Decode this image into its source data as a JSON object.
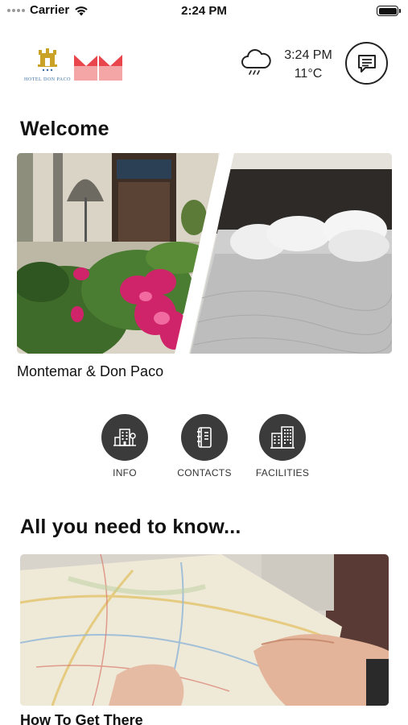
{
  "status_bar": {
    "carrier": "Carrier",
    "time": "2:24 PM"
  },
  "header": {
    "logo_text": "HOTEL DON PACO",
    "weather": {
      "time": "3:24 PM",
      "temperature": "11°C",
      "icon": "cloud-rain-icon"
    },
    "chat_icon": "chat-icon"
  },
  "welcome": {
    "title": "Welcome",
    "hotel_name": "Montemar & Don Paco"
  },
  "actions": [
    {
      "label": "INFO",
      "icon": "info-building-icon"
    },
    {
      "label": "CONTACTS",
      "icon": "address-book-icon"
    },
    {
      "label": "FACILITIES",
      "icon": "buildings-icon"
    }
  ],
  "know": {
    "title": "All you need to know...",
    "card_title": "How To Get There"
  },
  "colors": {
    "action_bg": "#3b3b3b",
    "brand_red": "#e8454c",
    "brand_pink": "#f4a6a6",
    "gold": "#c9a227"
  }
}
